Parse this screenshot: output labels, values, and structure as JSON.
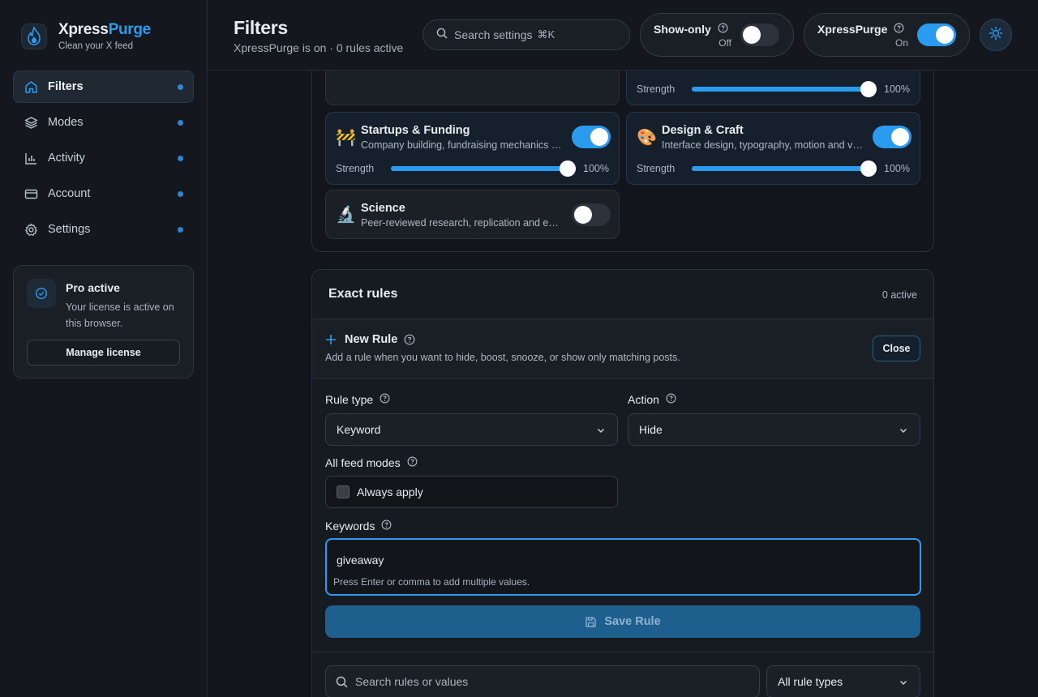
{
  "brand": {
    "name_part1": "Xpress",
    "name_part2": "Purge",
    "tagline": "Clean your X feed",
    "accent": "#2b9bef"
  },
  "sidebar": {
    "items": [
      {
        "label": "Filters",
        "icon": "home-icon",
        "active": true
      },
      {
        "label": "Modes",
        "icon": "layers-icon"
      },
      {
        "label": "Activity",
        "icon": "chart-icon"
      },
      {
        "label": "Account",
        "icon": "card-icon"
      },
      {
        "label": "Settings",
        "icon": "gear-icon"
      }
    ],
    "pro": {
      "title": "Pro active",
      "desc": "Your license is active on this browser.",
      "button": "Manage license"
    }
  },
  "header": {
    "title": "Filters",
    "subtitle": "XpressPurge is on · 0 rules active",
    "search": {
      "placeholder": "Search settings",
      "shortcut": "⌘K"
    },
    "show_only": {
      "title": "Show-only",
      "state": "Off"
    },
    "master": {
      "title": "XpressPurge",
      "state": "On"
    }
  },
  "categories": [
    {
      "name": "Startups & Funding",
      "emoji": "🚧",
      "desc": "Company building, fundraising mechanics and startup news",
      "enabled": true,
      "strength_label": "Strength",
      "strength": "100%"
    },
    {
      "name": "Design & Craft",
      "emoji": "🎨",
      "desc": "Interface design, typography, motion and visual craft",
      "enabled": true,
      "strength_label": "Strength",
      "strength": "100%"
    },
    {
      "name": "Science",
      "emoji": "🔬",
      "desc": "Peer-reviewed research, replication and experiments",
      "enabled": false
    },
    {
      "strength_label": "Strength",
      "strength": "100%"
    }
  ],
  "rules": {
    "title": "Exact rules",
    "count": "0 active",
    "new_rule": {
      "title": "New Rule",
      "desc": "Add a rule when you want to hide, boost, snooze, or show only matching posts.",
      "close": "Close"
    },
    "rule_type": {
      "label": "Rule type",
      "value": "Keyword"
    },
    "action": {
      "label": "Action",
      "value": "Hide"
    },
    "feed_modes": {
      "label": "All feed modes",
      "checkbox": "Always apply"
    },
    "keywords": {
      "label": "Keywords",
      "value": "giveaway",
      "hint": "Press Enter or comma to add multiple values."
    },
    "save": "Save Rule",
    "search_placeholder": "Search rules or values",
    "type_filter": "All rule types"
  }
}
